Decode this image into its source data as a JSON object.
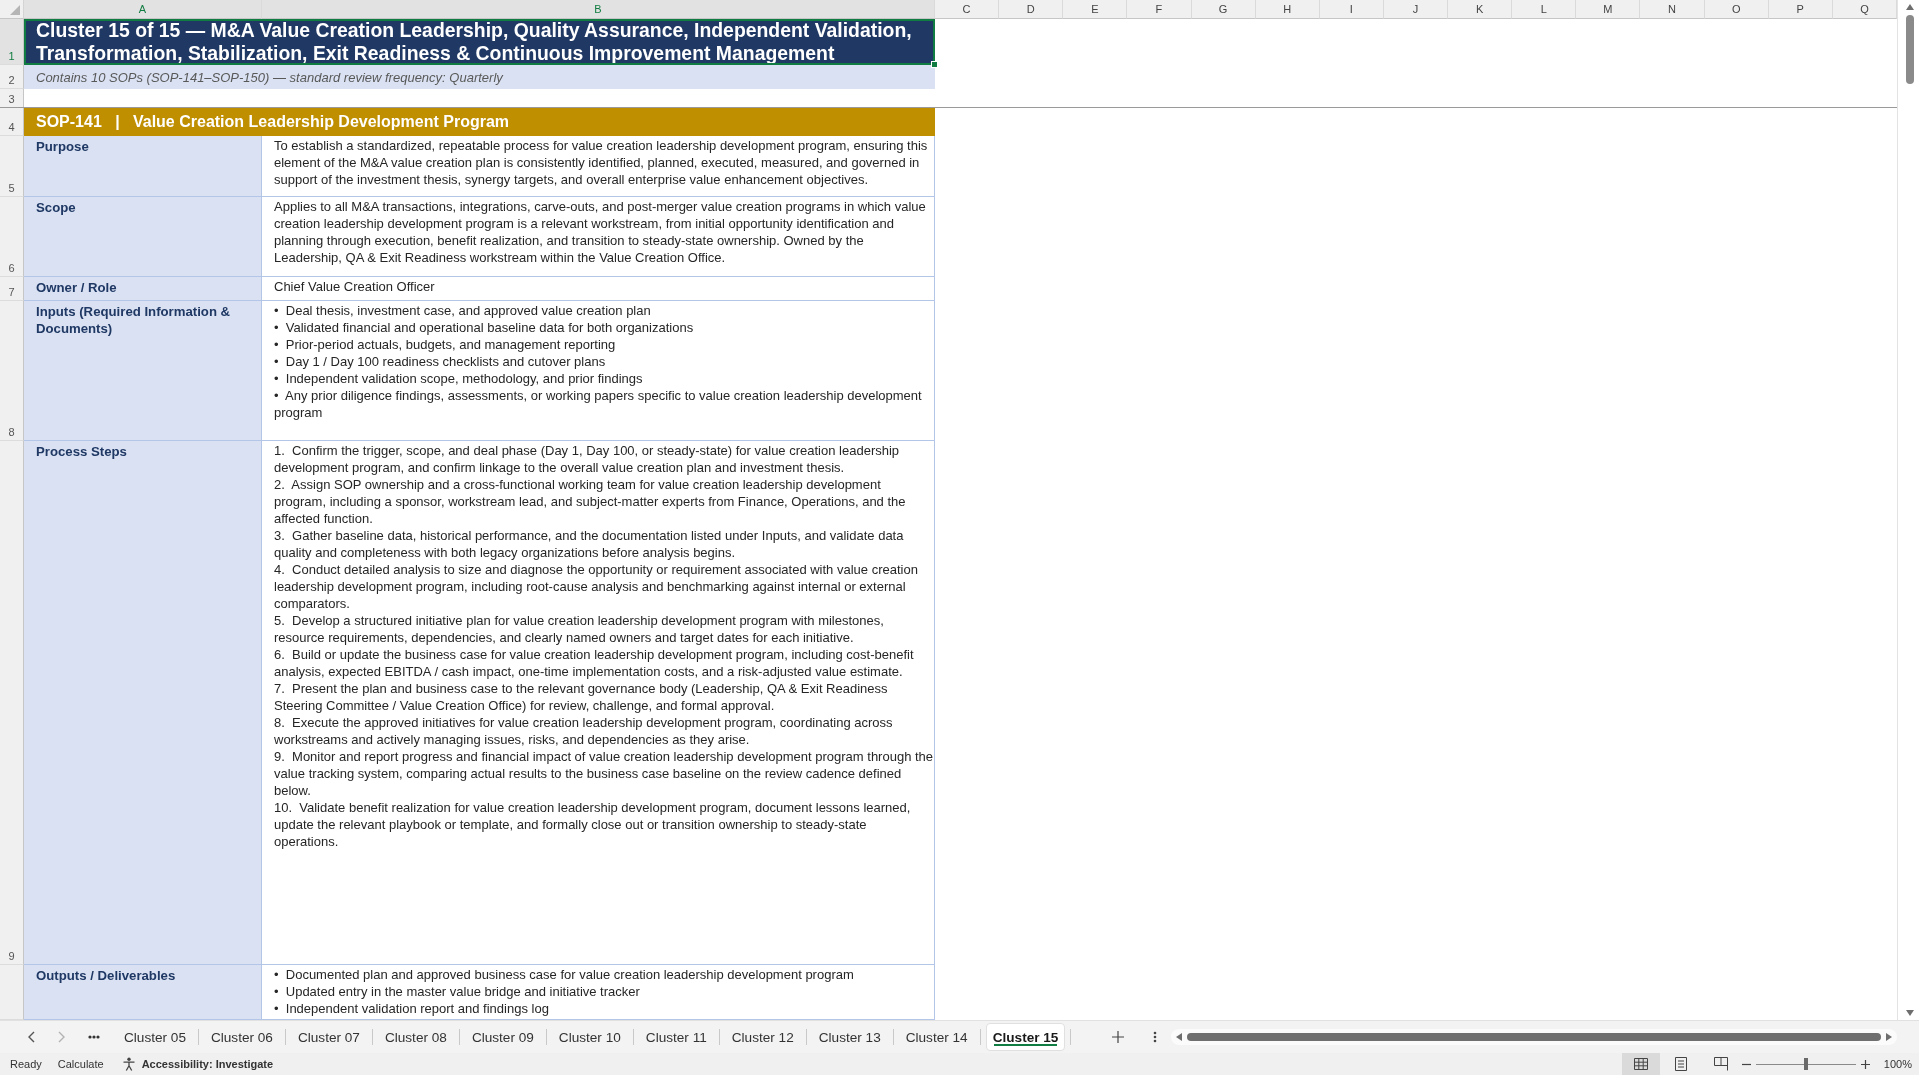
{
  "column_headers": [
    {
      "label": "A",
      "selected": true
    },
    {
      "label": "B",
      "selected": true
    },
    {
      "label": "C",
      "selected": false
    },
    {
      "label": "D",
      "selected": false
    },
    {
      "label": "E",
      "selected": false
    },
    {
      "label": "F",
      "selected": false
    },
    {
      "label": "G",
      "selected": false
    },
    {
      "label": "H",
      "selected": false
    },
    {
      "label": "I",
      "selected": false
    },
    {
      "label": "J",
      "selected": false
    },
    {
      "label": "K",
      "selected": false
    },
    {
      "label": "L",
      "selected": false
    },
    {
      "label": "M",
      "selected": false
    },
    {
      "label": "N",
      "selected": false
    },
    {
      "label": "O",
      "selected": false
    },
    {
      "label": "P",
      "selected": false
    },
    {
      "label": "Q",
      "selected": false
    }
  ],
  "row_headers": [
    {
      "label": "1",
      "selected": true
    },
    {
      "label": "2",
      "selected": false
    },
    {
      "label": "3",
      "selected": false
    },
    {
      "label": "4",
      "selected": false
    },
    {
      "label": "5",
      "selected": false
    },
    {
      "label": "6",
      "selected": false
    },
    {
      "label": "7",
      "selected": false
    },
    {
      "label": "8",
      "selected": false
    },
    {
      "label": "9",
      "selected": false
    }
  ],
  "title": {
    "text": "Cluster 15 of 15 — M&A Value Creation Leadership, Quality Assurance, Independent Validation, Transformation, Stabilization, Exit Readiness & Continuous Improvement Management",
    "selected": true
  },
  "subtitle": "Contains 10 SOPs (SOP-141–SOP-150) — standard review frequency: Quarterly",
  "sop_header": "SOP-141   |   Value Creation Leadership Development Program",
  "fields": [
    {
      "label": "Purpose",
      "kind": "paragraph",
      "text": "To establish a standardized, repeatable process for value creation leadership development program, ensuring this element of the M&A value creation plan is consistently identified, planned, executed, measured, and governed in support of the investment thesis, synergy targets, and overall enterprise value enhancement objectives."
    },
    {
      "label": "Scope",
      "kind": "paragraph",
      "text": "Applies to all M&A transactions, integrations, carve-outs, and post-merger value creation programs in which value creation leadership development program is a relevant workstream, from initial opportunity identification and planning through execution, benefit realization, and transition to steady-state ownership. Owned by the Leadership, QA & Exit Readiness workstream within the Value Creation Office."
    },
    {
      "label": "Owner / Role",
      "kind": "paragraph",
      "text": "Chief Value Creation Officer"
    },
    {
      "label": "Inputs (Required Information & Documents)",
      "kind": "list",
      "items": [
        "•  Deal thesis, investment case, and approved value creation plan",
        "•  Validated financial and operational baseline data for both organizations",
        "•  Prior-period actuals, budgets, and management reporting",
        "•  Day 1 / Day 100 readiness checklists and cutover plans",
        "•  Independent validation scope, methodology, and prior findings",
        "•  Any prior diligence findings, assessments, or working papers specific to value creation leadership development program"
      ]
    },
    {
      "label": "Process Steps",
      "kind": "list",
      "items": [
        "1.  Confirm the trigger, scope, and deal phase (Day 1, Day 100, or steady-state) for value creation leadership development program, and confirm linkage to the overall value creation plan and investment thesis.",
        "2.  Assign SOP ownership and a cross-functional working team for value creation leadership development program, including a sponsor, workstream lead, and subject-matter experts from Finance, Operations, and the affected function.",
        "3.  Gather baseline data, historical performance, and the documentation listed under Inputs, and validate data quality and completeness with both legacy organizations before analysis begins.",
        "4.  Conduct detailed analysis to size and diagnose the opportunity or requirement associated with value creation leadership development program, including root-cause analysis and benchmarking against internal or external comparators.",
        "5.  Develop a structured initiative plan for value creation leadership development program with milestones, resource requirements, dependencies, and clearly named owners and target dates for each initiative.",
        "6.  Build or update the business case for value creation leadership development program, including cost-benefit analysis, expected EBITDA / cash impact, one-time implementation costs, and a risk-adjusted value estimate.",
        "7.  Present the plan and business case to the relevant governance body (Leadership, QA & Exit Readiness Steering Committee / Value Creation Office) for review, challenge, and formal approval.",
        "8.  Execute the approved initiatives for value creation leadership development program, coordinating across workstreams and actively managing issues, risks, and dependencies as they arise.",
        "9.  Monitor and report progress and financial impact of value creation leadership development program through the value tracking system, comparing actual results to the business case baseline on the review cadence defined below.",
        "10.  Validate benefit realization for value creation leadership development program, document lessons learned, update the relevant playbook or template, and formally close out or transition ownership to steady-state operations."
      ]
    },
    {
      "label": "Outputs / Deliverables",
      "kind": "list",
      "items": [
        "•  Documented plan and approved business case for value creation leadership development program",
        "•  Updated entry in the master value bridge and initiative tracker",
        "•  Independent validation report and findings log"
      ]
    }
  ],
  "tab_scroll": [
    {
      "kind": "previous",
      "disabled": false
    },
    {
      "kind": "next",
      "disabled": true
    }
  ],
  "sheet_tabs": [
    {
      "label": "Cluster 05",
      "selected": false
    },
    {
      "label": "Cluster 06",
      "selected": false
    },
    {
      "label": "Cluster 07",
      "selected": false
    },
    {
      "label": "Cluster 08",
      "selected": false
    },
    {
      "label": "Cluster 09",
      "selected": false
    },
    {
      "label": "Cluster 10",
      "selected": false
    },
    {
      "label": "Cluster 11",
      "selected": false
    },
    {
      "label": "Cluster 12",
      "selected": false
    },
    {
      "label": "Cluster 13",
      "selected": false
    },
    {
      "label": "Cluster 14",
      "selected": false
    },
    {
      "label": "Cluster 15",
      "selected": true
    }
  ],
  "status_bar": {
    "mode": "Ready",
    "calculate": "Calculate",
    "accessibility": "Accessibility: Investigate",
    "view_buttons": [
      {
        "kind": "normal",
        "selected": true
      },
      {
        "kind": "page_layout",
        "selected": false
      },
      {
        "kind": "page_break_preview",
        "selected": false
      }
    ],
    "zoom_slider": {
      "level": 0.5
    },
    "zoom": "100%"
  }
}
